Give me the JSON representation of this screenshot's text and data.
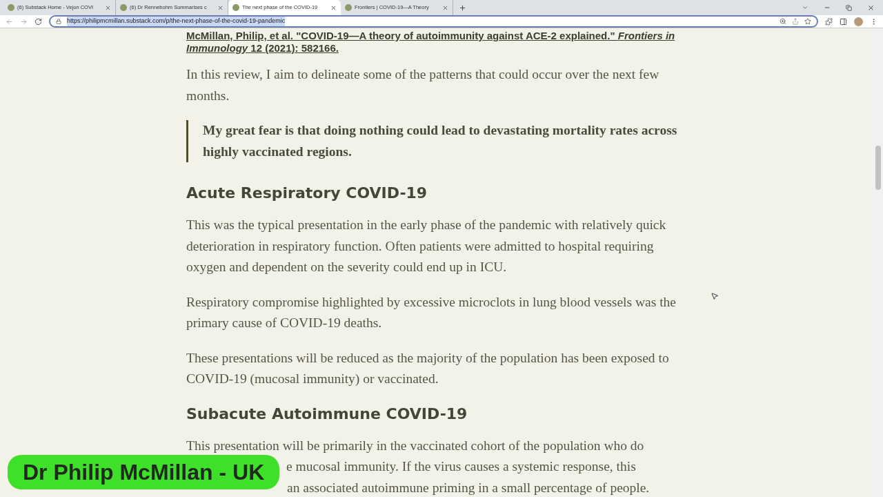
{
  "tabs": [
    {
      "title": "(6) Substack Home - Vejon COVI",
      "selected": false
    },
    {
      "title": "(6) Dr Rennebohm Summarises c",
      "selected": false
    },
    {
      "title": "The next phase of the COVID-19",
      "selected": true
    },
    {
      "title": "Frontiers | COVID-19—A Theory",
      "selected": false
    }
  ],
  "address_bar": {
    "url": "https://philipmcmillan.substack.com/p/the-next-phase-of-the-covid-19-pandemic"
  },
  "article": {
    "blocks": [
      {
        "kind": "citation",
        "text": "McMillan, Philip, et al. \"COVID-19—A theory of autoimmunity against ACE-2 explained.\" *Frontiers in Immunology* 12 (2021): 582166."
      },
      {
        "kind": "paragraph",
        "text": "In this review, I aim to delineate some of the patterns that could occur over the next few months."
      },
      {
        "kind": "quote",
        "text": "My great fear is that doing nothing could lead to devastating mortality rates across highly vaccinated regions."
      },
      {
        "kind": "heading",
        "text": "Acute Respiratory COVID-19"
      },
      {
        "kind": "paragraph",
        "text": "This was the typical presentation in the early phase of the pandemic with relatively quick deterioration in respiratory function. Often patients were admitted to hospital requiring oxygen and dependent on the severity could end up in ICU."
      },
      {
        "kind": "paragraph",
        "text": "Respiratory compromise highlighted by excessive microclots in lung blood vessels was the primary cause of COVID-19 deaths."
      },
      {
        "kind": "paragraph",
        "text": "These presentations will be reduced as the majority of the population has been exposed to COVID-19 (mucosal immunity) or vaccinated."
      },
      {
        "kind": "heading",
        "text": "Subacute Autoimmune COVID-19"
      },
      {
        "kind": "partial",
        "lines": [
          "This presentation will be primarily in the vaccinated cohort of the population who do",
          "e mucosal immunity. If the virus causes a systemic response, this",
          "an associated autoimmune priming in a small percentage of people."
        ]
      }
    ]
  },
  "caption": {
    "text": "Dr Philip McMillan - UK"
  }
}
